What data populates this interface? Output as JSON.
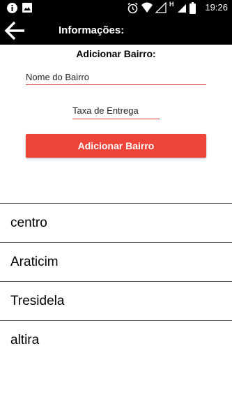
{
  "status_bar": {
    "time": "19:26",
    "network_label": "H",
    "icons": [
      "info-icon",
      "image-icon",
      "alarm-icon",
      "wifi-icon",
      "signal-icon",
      "battery-icon"
    ]
  },
  "toolbar": {
    "back_icon": "back-arrow-icon",
    "title": "Informações:"
  },
  "form": {
    "section_title": "Adicionar Bairro:",
    "name_placeholder": "Nome do Bairro",
    "fee_placeholder": "Taxa de Entrega",
    "submit_label": "Adicionar Bairro",
    "accent_color": "#ef4438"
  },
  "neighborhoods": [
    "centro",
    "Araticim",
    "Tresidela",
    "altira"
  ]
}
